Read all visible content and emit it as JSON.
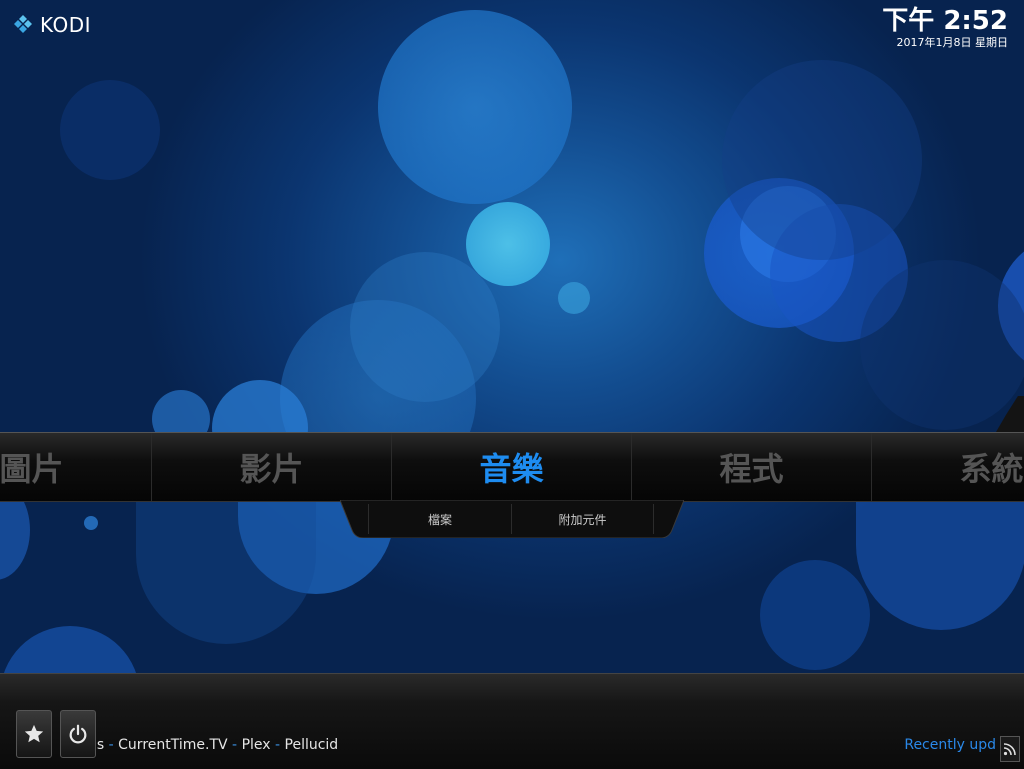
{
  "app": {
    "logo_text": "KODI"
  },
  "clock": {
    "time": "下午 2:52",
    "date": "2017年1月8日 星期日"
  },
  "main_menu": {
    "items": [
      {
        "label": "圖片",
        "active": false
      },
      {
        "label": "影片",
        "active": false
      },
      {
        "label": "音樂",
        "active": true
      },
      {
        "label": "程式",
        "active": false
      },
      {
        "label": "系統",
        "active": false
      }
    ]
  },
  "submenu": {
    "items": [
      {
        "label": "檔案"
      },
      {
        "label": "附加元件"
      }
    ]
  },
  "footer": {
    "ticker": [
      "gs",
      "CurrentTime.TV",
      "Plex",
      "Pellucid"
    ],
    "ticker_separator": "-",
    "recently_updated": "Recently upd",
    "favourites_icon": "star-icon",
    "power_icon": "power-icon",
    "rss_icon": "rss-icon"
  },
  "colors": {
    "accent": "#1e8cf0",
    "inactive_menu": "#555555",
    "background": "#0b3570"
  }
}
